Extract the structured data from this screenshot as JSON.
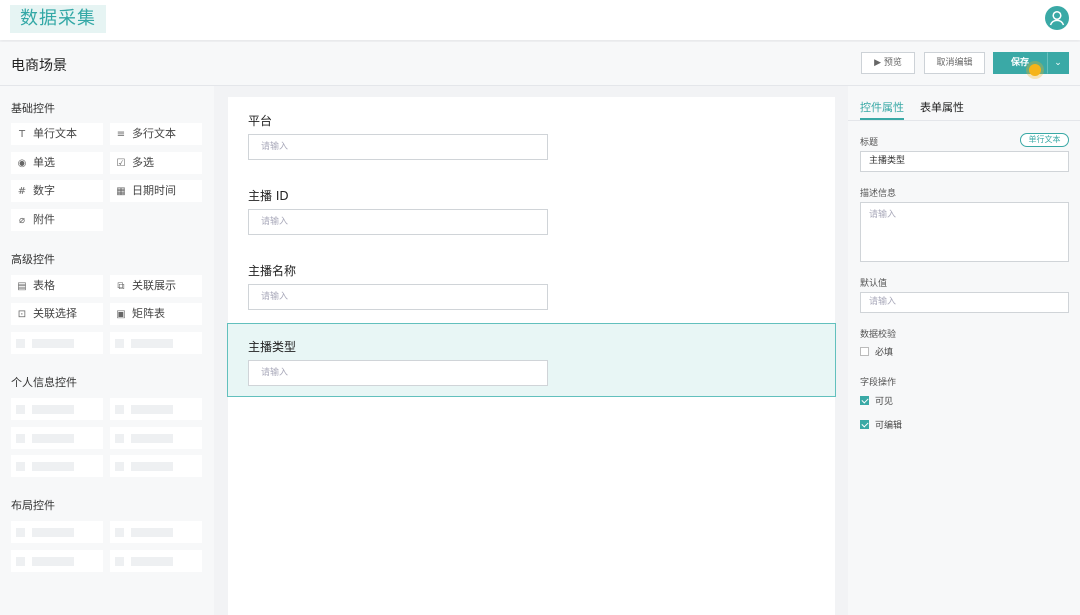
{
  "app": {
    "title": "数据采集"
  },
  "header": {
    "title": "电商场景",
    "preview_label": "▶ 预览",
    "cancel_label": "取消编辑",
    "save_label": "保存",
    "dropdown_glyph": "⌄"
  },
  "palette": {
    "basic_title": "基础控件",
    "basic_items": [
      {
        "label": "单行文本",
        "icon": "text-field-icon",
        "glyph": "T"
      },
      {
        "label": "多行文本",
        "icon": "textarea-icon",
        "glyph": "≡"
      },
      {
        "label": "单选",
        "icon": "radio-icon",
        "glyph": "◉"
      },
      {
        "label": "多选",
        "icon": "checkbox-icon",
        "glyph": "☑"
      },
      {
        "label": "数字",
        "icon": "number-icon",
        "glyph": "#"
      },
      {
        "label": "日期时间",
        "icon": "calendar-icon",
        "glyph": "▦"
      },
      {
        "label": "附件",
        "icon": "paperclip-icon",
        "glyph": "⌀"
      }
    ],
    "advanced_title": "高级控件",
    "advanced_items": [
      {
        "label": "表格",
        "icon": "table-icon",
        "glyph": "▤"
      },
      {
        "label": "关联展示",
        "icon": "link-display-icon",
        "glyph": "⧉"
      },
      {
        "label": "关联选择",
        "icon": "link-select-icon",
        "glyph": "⊡"
      },
      {
        "label": "矩阵表",
        "icon": "matrix-icon",
        "glyph": "▣"
      }
    ],
    "personal_title": "个人信息控件",
    "layout_title": "布局控件"
  },
  "form": {
    "fields": [
      {
        "label": "平台",
        "placeholder": "请输入"
      },
      {
        "label": "主播 ID",
        "placeholder": "请输入"
      },
      {
        "label": "主播名称",
        "placeholder": "请输入"
      },
      {
        "label": "主播类型",
        "placeholder": "请输入"
      }
    ]
  },
  "props": {
    "tab_control": "控件属性",
    "tab_form": "表单属性",
    "title_label": "标题",
    "type_badge": "单行文本",
    "title_value": "主播类型",
    "desc_label": "描述信息",
    "desc_placeholder": "请输入",
    "default_label": "默认值",
    "default_placeholder": "请输入",
    "validation_label": "数据校验",
    "required_label": "必填",
    "field_ops_label": "字段操作",
    "visible_label": "可见",
    "editable_label": "可编辑",
    "required_checked": false,
    "visible_checked": true,
    "editable_checked": true
  },
  "colors": {
    "accent": "#3aa9a6",
    "selected_bg": "#e8f6f5",
    "cursor": "#f6b418"
  }
}
